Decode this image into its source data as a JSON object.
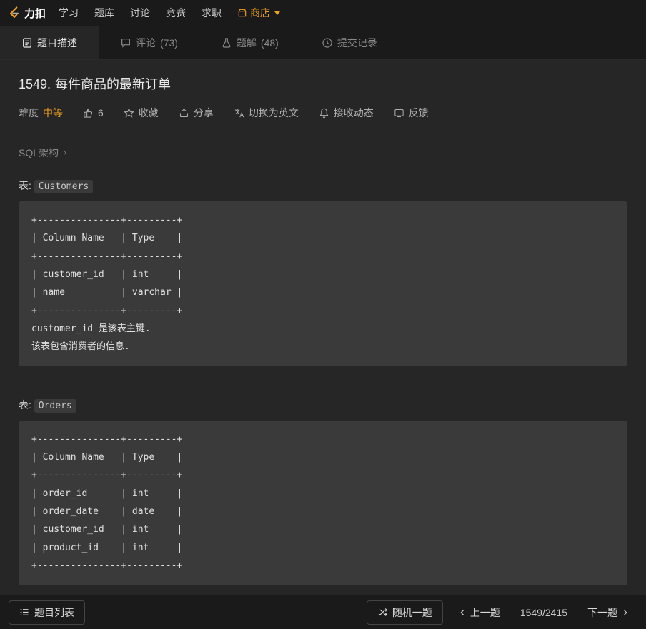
{
  "brand": "力扣",
  "nav": {
    "items": [
      "学习",
      "题库",
      "讨论",
      "竞赛",
      "求职"
    ],
    "shop": "商店"
  },
  "tabs": {
    "desc": "题目描述",
    "comments_label": "评论",
    "comments_count": "(73)",
    "solutions_label": "题解",
    "solutions_count": "(48)",
    "submissions": "提交记录"
  },
  "problem": {
    "number": "1549.",
    "title": "每件商品的最新订单"
  },
  "meta": {
    "difficulty_label": "难度",
    "difficulty_value": "中等",
    "likes": "6",
    "favorite": "收藏",
    "share": "分享",
    "toggle_lang": "切换为英文",
    "subscribe": "接收动态",
    "feedback": "反馈"
  },
  "schema_link": "SQL架构",
  "tables": {
    "label_prefix": "表:",
    "customers": {
      "name": "Customers",
      "block": "+---------------+---------+\n| Column Name   | Type    |\n+---------------+---------+\n| customer_id   | int     |\n| name          | varchar |\n+---------------+---------+\ncustomer_id 是该表主键.\n该表包含消费者的信息."
    },
    "orders": {
      "name": "Orders",
      "block": "+---------------+---------+\n| Column Name   | Type    |\n+---------------+---------+\n| order_id      | int     |\n| order_date    | date    |\n| customer_id   | int     |\n| product_id    | int     |\n+---------------+---------+"
    }
  },
  "bottom": {
    "list": "题目列表",
    "random": "随机一题",
    "prev": "上一题",
    "counter": "1549/2415",
    "next": "下一题"
  }
}
